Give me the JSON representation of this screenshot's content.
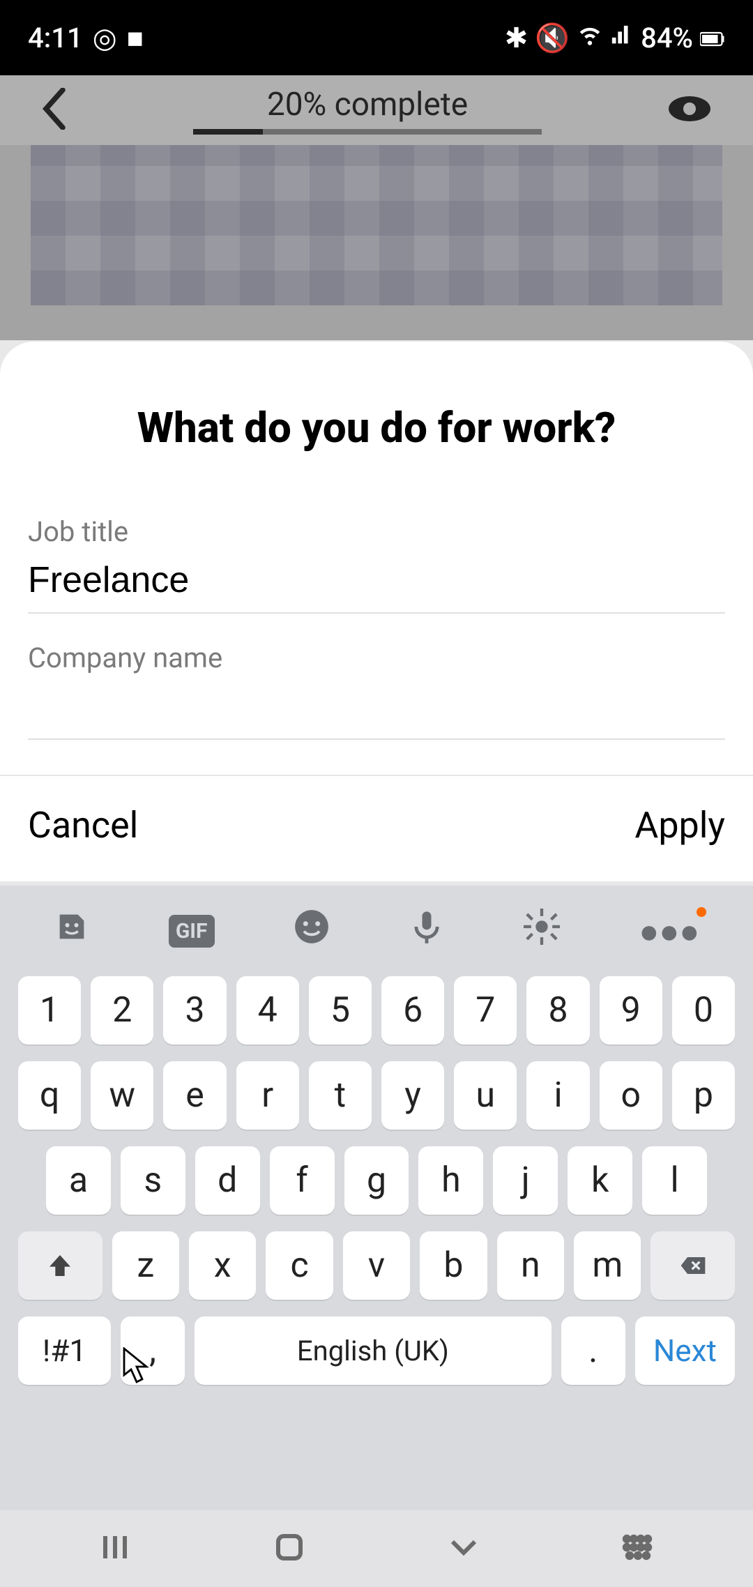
{
  "status_bar": {
    "time": "4:11",
    "battery_text": "84%",
    "icons": [
      "alarm-icon",
      "camera-icon",
      "bluetooth-icon",
      "mute-icon",
      "wifi-icon",
      "signal-icon",
      "battery-icon"
    ]
  },
  "header": {
    "progress_label": "20% complete",
    "progress_percent": 20
  },
  "modal": {
    "title": "What do you do for work?",
    "job_title_label": "Job title",
    "job_title_value": "Freelance",
    "company_label": "Company name",
    "company_value": "",
    "cancel_label": "Cancel",
    "apply_label": "Apply"
  },
  "keyboard": {
    "toolbar_icons": [
      "sticker-icon",
      "gif-icon",
      "emoji-icon",
      "mic-icon",
      "gear-icon",
      "more-icon"
    ],
    "gif_label": "GIF",
    "row_numbers": [
      "1",
      "2",
      "3",
      "4",
      "5",
      "6",
      "7",
      "8",
      "9",
      "0"
    ],
    "row_q": [
      "q",
      "w",
      "e",
      "r",
      "t",
      "y",
      "u",
      "i",
      "o",
      "p"
    ],
    "row_a": [
      "a",
      "s",
      "d",
      "f",
      "g",
      "h",
      "j",
      "k",
      "l"
    ],
    "row_z": [
      "z",
      "x",
      "c",
      "v",
      "b",
      "n",
      "m"
    ],
    "sym_label": "!#1",
    "comma": ",",
    "period": ".",
    "space_label": "English (UK)",
    "next_label": "Next"
  },
  "nav": {
    "buttons": [
      "recents",
      "home",
      "back",
      "keyboard-toggle"
    ]
  }
}
